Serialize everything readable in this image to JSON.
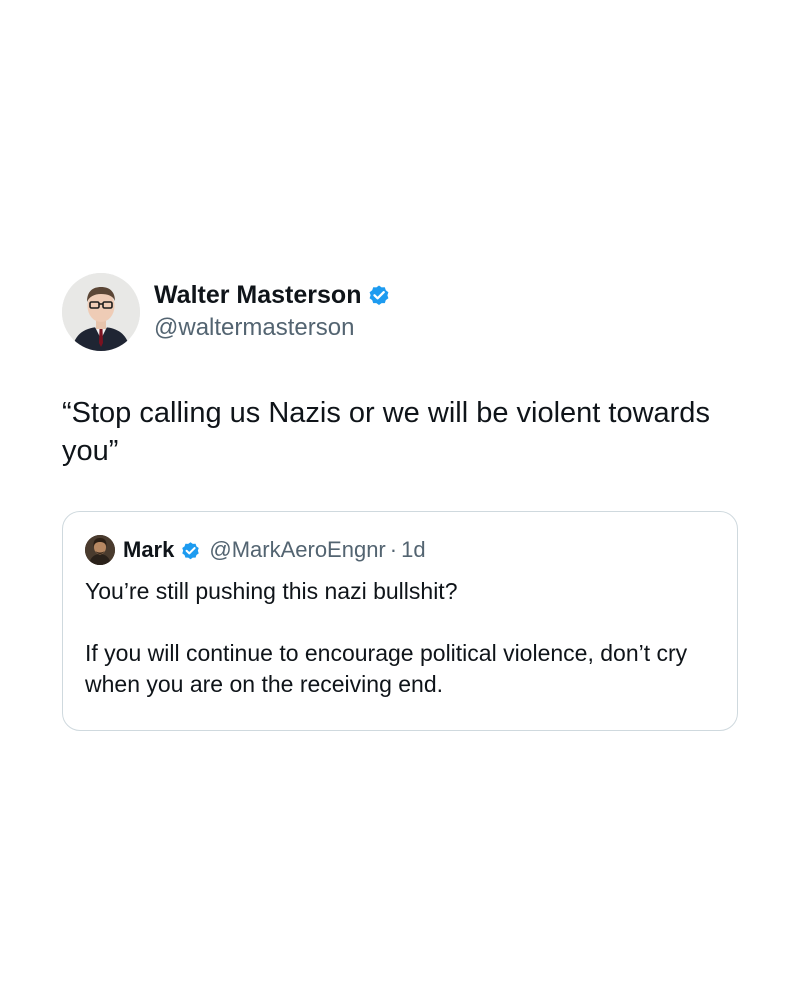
{
  "post": {
    "author": {
      "display_name": "Walter Masterson",
      "handle": "@waltermasterson",
      "verified": true,
      "avatar_icon": "person-avatar"
    },
    "text": "“Stop calling us Nazis or we will be violent towards you”"
  },
  "quote": {
    "author": {
      "display_name": "Mark",
      "handle": "@MarkAeroEngnr",
      "verified": true,
      "avatar_icon": "person-avatar"
    },
    "separator": "·",
    "time": "1d",
    "text": "You’re still pushing this nazi bullshit?\n\nIf you will continue to encourage political violence, don’t cry when you are on the receiving end."
  },
  "colors": {
    "background": "#ffffff",
    "text_primary": "#0f1419",
    "text_secondary": "#536471",
    "verified_blue": "#1d9bf0",
    "card_border": "#cfd9de"
  }
}
